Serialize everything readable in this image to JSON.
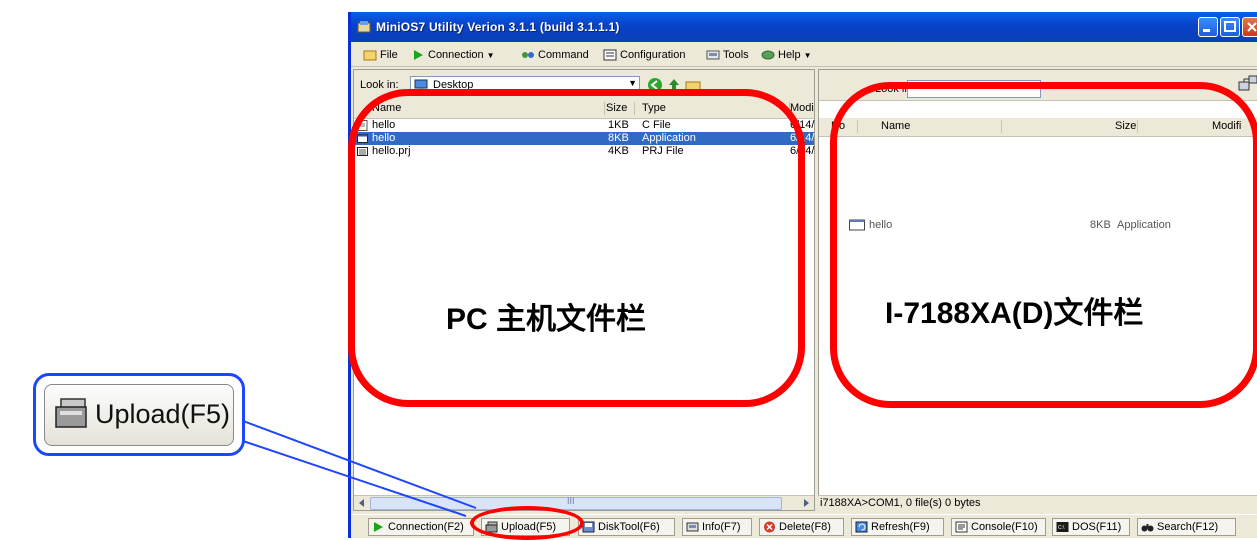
{
  "window": {
    "title": "MiniOS7 Utility Verion 3.1.1 (build 3.1.1.1)"
  },
  "menu": {
    "file": "File",
    "connection": "Connection",
    "command": "Command",
    "configuration": "Configuration",
    "tools": "Tools",
    "help": "Help"
  },
  "left_pane": {
    "look_in_label": "Look in:",
    "look_in_value": "Desktop",
    "columns": {
      "name": "Name",
      "size": "Size",
      "type": "Type",
      "modified": "Modi"
    },
    "files": [
      {
        "name": "hello",
        "size": "1KB",
        "type": "C File",
        "modified": "6/14/"
      },
      {
        "name": "hello",
        "size": "8KB",
        "type": "Application",
        "modified": "6/14/"
      },
      {
        "name": "hello.prj",
        "size": "4KB",
        "type": "PRJ File",
        "modified": "6/14/"
      }
    ],
    "scroll_mark": "III"
  },
  "right_pane": {
    "look_in_label": "Look in:",
    "columns": {
      "no": "No",
      "name": "Name",
      "size": "Size",
      "modified": "Modifi"
    },
    "files": [
      {
        "name": "hello",
        "size": "8KB",
        "type": "Application"
      }
    ],
    "status": "i7188XA>COM1, 0 file(s) 0 bytes"
  },
  "toolbar": {
    "connection": "Connection(F2)",
    "upload": "Upload(F5)",
    "disktool": "DiskTool(F6)",
    "info": "Info(F7)",
    "delete": "Delete(F8)",
    "refresh": "Refresh(F9)",
    "console": "Console(F10)",
    "dos": "DOS(F11)",
    "search": "Search(F12)"
  },
  "annotations": {
    "pc_label": "PC 主机文件栏",
    "device_label": "I-7188XA(D)文件栏",
    "zoom_label": "Upload(F5)"
  },
  "colors": {
    "highlight_red": "#ff0000",
    "callout_blue": "#1f46ff",
    "selection": "#316ac5",
    "titlebar": "#0a5fe8"
  }
}
